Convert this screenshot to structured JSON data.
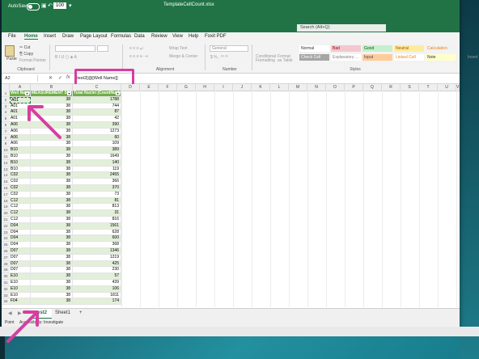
{
  "titlebar": {
    "autosave_label": "AutoSave",
    "toggle_state": "Off",
    "zoom_value": "100",
    "doc_title": "TemplateCellCount.xlsx",
    "search_placeholder": "Search (Alt+Q)",
    "bg_color": "#217346"
  },
  "menu": [
    "File",
    "Home",
    "Insert",
    "Draw",
    "Page Layout",
    "Formulas",
    "Data",
    "Review",
    "View",
    "Help",
    "Foxit PDF"
  ],
  "menu_active": "Home",
  "ribbon": {
    "paste": "Paste",
    "cut": "Cut",
    "copy": "Copy",
    "format_painter": "Format Painter",
    "clipboard": "Clipboard",
    "wrap_text": "Wrap Text",
    "merge_center": "Merge & Center",
    "alignment": "Alignment",
    "number_format": "General",
    "number": "Number",
    "conditional": "Conditional Formatting",
    "format_table": "Format as Table",
    "styles_label": "Styles",
    "styles": [
      {
        "label": "Normal",
        "bg": "#ffffff",
        "fg": "#333333"
      },
      {
        "label": "Bad",
        "bg": "#f4c7ce",
        "fg": "#9c0006"
      },
      {
        "label": "Good",
        "bg": "#c6efce",
        "fg": "#006100"
      },
      {
        "label": "Neutral",
        "bg": "#ffeb9c",
        "fg": "#9c5700"
      },
      {
        "label": "Calculation",
        "bg": "#f2f2f2",
        "fg": "#fa7d00"
      },
      {
        "label": "Check Cell",
        "bg": "#a5a5a5",
        "fg": "#ffffff"
      },
      {
        "label": "Explanatory ...",
        "bg": "#ffffff",
        "fg": "#7f7f7f"
      },
      {
        "label": "Input",
        "bg": "#ffcc99",
        "fg": "#3f3f76"
      },
      {
        "label": "Linked Cell",
        "bg": "#ffffff",
        "fg": "#fa7d00"
      },
      {
        "label": "Note",
        "bg": "#ffffcc",
        "fg": "#333333"
      }
    ],
    "insert": "Insert",
    "delete": "Del"
  },
  "formula_bar": {
    "name_box": "A2",
    "cancel": "✕",
    "confirm": "✓",
    "fx": "fx",
    "formula": "=test2[@[Well Name]]"
  },
  "columns": [
    "A",
    "B",
    "C",
    "D",
    "E",
    "F",
    "G",
    "H",
    "I",
    "J",
    "K",
    "L",
    "M",
    "N",
    "O",
    "P",
    "Q",
    "R",
    "S",
    "T",
    "U",
    "V"
  ],
  "table": {
    "headers": [
      "Well Name",
      "MEASUREMENT SET ID",
      "Total Nuclei (CountNuclei)"
    ],
    "rows": [
      [
        "A01",
        "38",
        "1788"
      ],
      [
        "A01",
        "38",
        "744"
      ],
      [
        "A01",
        "38",
        "87"
      ],
      [
        "A01",
        "38",
        "42"
      ],
      [
        "A06",
        "38",
        "390"
      ],
      [
        "A06",
        "38",
        "1273"
      ],
      [
        "A06",
        "38",
        "60"
      ],
      [
        "A06",
        "38",
        "109"
      ],
      [
        "B10",
        "38",
        "389"
      ],
      [
        "B10",
        "38",
        "1649"
      ],
      [
        "B10",
        "38",
        "140"
      ],
      [
        "B10",
        "38",
        "119"
      ],
      [
        "C02",
        "38",
        "2455"
      ],
      [
        "C02",
        "38",
        "366"
      ],
      [
        "C02",
        "38",
        "370"
      ],
      [
        "C02",
        "38",
        "73"
      ],
      [
        "C12",
        "38",
        "81"
      ],
      [
        "C12",
        "38",
        "813"
      ],
      [
        "C12",
        "38",
        "31"
      ],
      [
        "C12",
        "38",
        "816"
      ],
      [
        "D04",
        "38",
        "1561"
      ],
      [
        "D04",
        "38",
        "628"
      ],
      [
        "D04",
        "38",
        "600"
      ],
      [
        "D04",
        "38",
        "368"
      ],
      [
        "D07",
        "38",
        "1346"
      ],
      [
        "D07",
        "38",
        "1219"
      ],
      [
        "D07",
        "38",
        "425"
      ],
      [
        "D07",
        "38",
        "230"
      ],
      [
        "E10",
        "38",
        "57"
      ],
      [
        "E10",
        "38",
        "439"
      ],
      [
        "E10",
        "38",
        "106"
      ],
      [
        "E10",
        "38",
        "1811"
      ],
      [
        "F04",
        "38",
        "174"
      ],
      [
        "F04",
        "38",
        "55"
      ],
      [
        "F04",
        "38",
        "1641"
      ],
      [
        "F04",
        "38",
        "1211"
      ]
    ]
  },
  "sheet_tabs": [
    "test2",
    "Sheet1"
  ],
  "active_sheet": "test2",
  "add_sheet": "+",
  "status": {
    "mode": "Point",
    "accessibility": "Accessibility: Investigate"
  },
  "highlight_color": "#d63ea0"
}
